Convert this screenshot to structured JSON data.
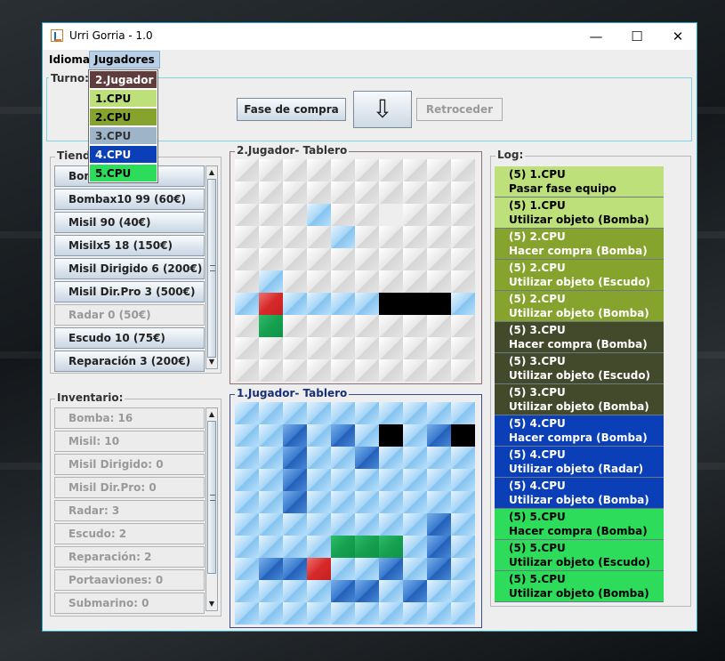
{
  "window": {
    "title": "Urri Gorria - 1.0",
    "min_glyph": "—",
    "max_glyph": "☐",
    "close_glyph": "✕"
  },
  "menubar": {
    "idioma": "Idioma",
    "jugadores": "Jugadores"
  },
  "players_menu": {
    "items": [
      {
        "label": "2.Jugador",
        "bg": "#5f3d3d",
        "fg": "#ffffff"
      },
      {
        "label": "1.CPU",
        "bg": "#bde07a",
        "fg": "#000000"
      },
      {
        "label": "2.CPU",
        "bg": "#86a32e",
        "fg": "#000000"
      },
      {
        "label": "3.CPU",
        "bg": "#9eb4c8",
        "fg": "#333333"
      },
      {
        "label": "4.CPU",
        "bg": "#0a3fb8",
        "fg": "#ffffff"
      },
      {
        "label": "5.CPU",
        "bg": "#2cdc5a",
        "fg": "#000000"
      }
    ]
  },
  "turn": {
    "legend": "Turno: (",
    "buy_phase_label": "Fase de compra",
    "arrow_icon": "⇩",
    "back_label": "Retroceder"
  },
  "shop": {
    "legend": "Tienda",
    "items": [
      {
        "label": "Bomba",
        "disabled": false
      },
      {
        "label": "Bombax10 99 (60€)",
        "disabled": false
      },
      {
        "label": "Misil 90 (40€)",
        "disabled": false
      },
      {
        "label": "Misilx5 18 (150€)",
        "disabled": false
      },
      {
        "label": "Misil Dirigido 6 (200€)",
        "disabled": false
      },
      {
        "label": "Misil Dir.Pro 3 (500€)",
        "disabled": false
      },
      {
        "label": "Radar 0 (50€)",
        "disabled": true
      },
      {
        "label": "Escudo 10 (75€)",
        "disabled": false
      },
      {
        "label": "Reparación 3 (200€)",
        "disabled": false
      }
    ]
  },
  "inventory": {
    "legend": "Inventario:",
    "items": [
      {
        "label": "Bomba: 16"
      },
      {
        "label": "Misil: 10"
      },
      {
        "label": "Misil Dirigido: 0"
      },
      {
        "label": "Misil Dir.Pro: 0"
      },
      {
        "label": "Radar: 3"
      },
      {
        "label": "Escudo: 2"
      },
      {
        "label": "Reparación: 2"
      },
      {
        "label": "Portaaviones: 0"
      },
      {
        "label": "Submarino: 0"
      }
    ]
  },
  "board_enemy": {
    "legend": "2.Jugador- Tablero",
    "cells": [
      "0000000000",
      "0000000000",
      "0001006000",
      "0000100000",
      "0000000000",
      "0100000000",
      "1311115551",
      "0400000000",
      "0000000000",
      "0000000000"
    ]
  },
  "board_own": {
    "legend": "1.Jugador- Tablero",
    "cells": [
      "1111111111",
      "1121215125",
      "1121121111",
      "1121111111",
      "1121111111",
      "1111111121",
      "1111444121",
      "1223112121",
      "1111221211",
      "1111111111"
    ]
  },
  "log": {
    "legend": "Log:",
    "entries": [
      {
        "line1": "(5) 1.CPU",
        "line2": "Pasar fase equipo",
        "bg": "#bde07a",
        "fg": "#000000"
      },
      {
        "line1": "(5) 1.CPU",
        "line2": "Utilizar objeto (Bomba)",
        "bg": "#bde07a",
        "fg": "#000000"
      },
      {
        "line1": "(5) 2.CPU",
        "line2": "Hacer compra (Bomba)",
        "bg": "#86a32e",
        "fg": "#ffffff"
      },
      {
        "line1": "(5) 2.CPU",
        "line2": "Utilizar objeto (Escudo)",
        "bg": "#86a32e",
        "fg": "#ffffff"
      },
      {
        "line1": "(5) 2.CPU",
        "line2": "Utilizar objeto (Bomba)",
        "bg": "#86a32e",
        "fg": "#ffffff"
      },
      {
        "line1": "(5) 3.CPU",
        "line2": "Hacer compra (Bomba)",
        "bg": "#434a2c",
        "fg": "#ffffff"
      },
      {
        "line1": "(5) 3.CPU",
        "line2": "Utilizar objeto (Escudo)",
        "bg": "#434a2c",
        "fg": "#ffffff"
      },
      {
        "line1": "(5) 3.CPU",
        "line2": "Utilizar objeto (Bomba)",
        "bg": "#434a2c",
        "fg": "#ffffff"
      },
      {
        "line1": "(5) 4.CPU",
        "line2": "Hacer compra (Bomba)",
        "bg": "#0a3fb8",
        "fg": "#ffffff"
      },
      {
        "line1": "(5) 4.CPU",
        "line2": "Utilizar objeto (Radar)",
        "bg": "#0a3fb8",
        "fg": "#ffffff"
      },
      {
        "line1": "(5) 4.CPU",
        "line2": "Utilizar objeto (Bomba)",
        "bg": "#0a3fb8",
        "fg": "#ffffff"
      },
      {
        "line1": "(5) 5.CPU",
        "line2": "Hacer compra (Bomba)",
        "bg": "#2cdc5a",
        "fg": "#000000"
      },
      {
        "line1": "(5) 5.CPU",
        "line2": "Utilizar objeto (Escudo)",
        "bg": "#2cdc5a",
        "fg": "#000000"
      },
      {
        "line1": "(5) 5.CPU",
        "line2": "Utilizar objeto (Bomba)",
        "bg": "#2cdc5a",
        "fg": "#000000"
      }
    ]
  }
}
